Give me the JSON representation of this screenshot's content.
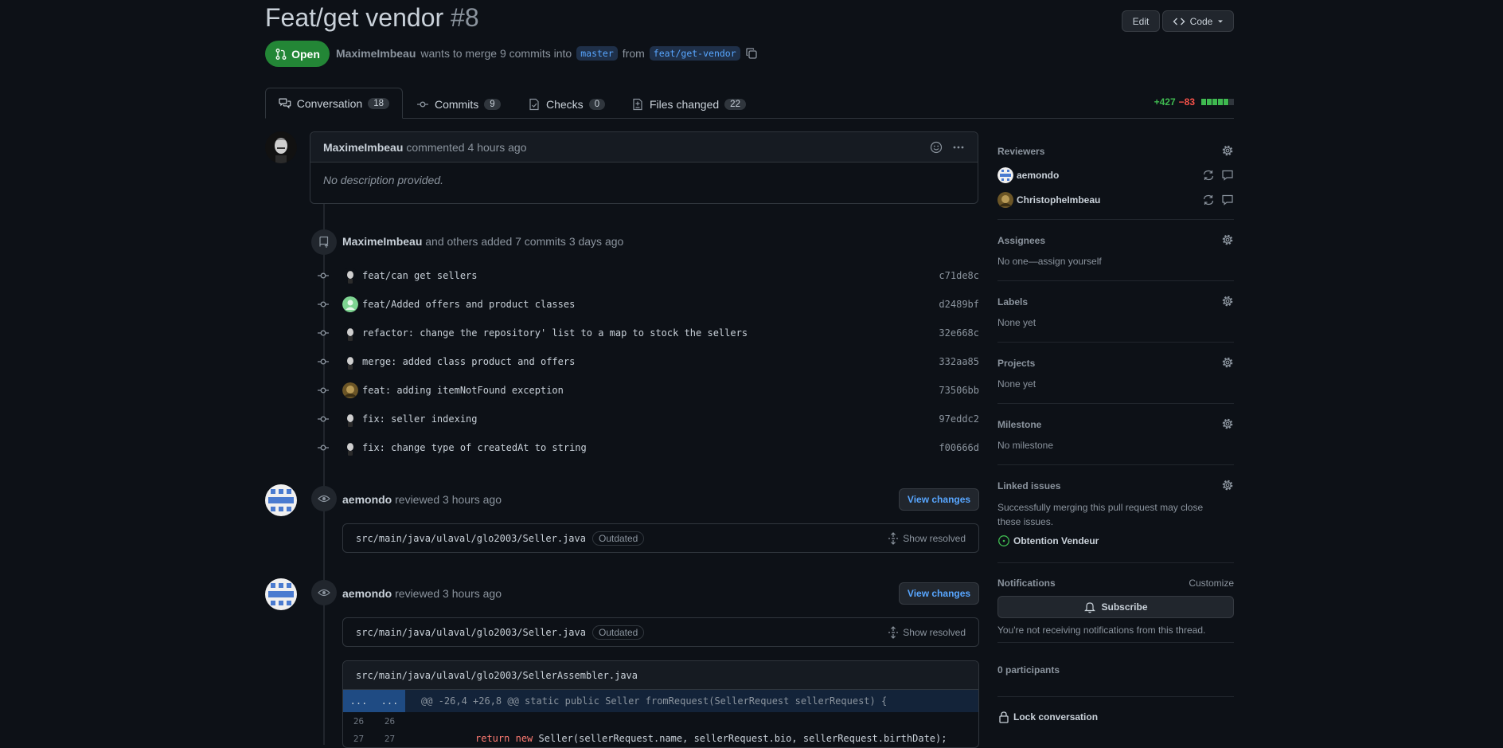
{
  "header": {
    "title": "Feat/get vendor",
    "number": "#8",
    "edit_label": "Edit",
    "code_label": "Code",
    "state": "Open",
    "author": "MaximeImbeau",
    "merge_text_pre": "wants to merge 9 commits into",
    "base_branch": "master",
    "from_text": "from",
    "head_branch": "feat/get-vendor"
  },
  "tabs": [
    {
      "label": "Conversation",
      "count": "18"
    },
    {
      "label": "Commits",
      "count": "9"
    },
    {
      "label": "Checks",
      "count": "0"
    },
    {
      "label": "Files changed",
      "count": "22"
    }
  ],
  "diffstat": {
    "additions": "+427",
    "deletions": "−83"
  },
  "comment": {
    "author": "MaximeImbeau",
    "action": "commented",
    "time": "4 hours ago",
    "body": "No description provided."
  },
  "commits_event": {
    "author": "MaximeImbeau",
    "text": "and others added 7 commits",
    "time": "3 days ago"
  },
  "commits": [
    {
      "message": "feat/can get sellers",
      "sha": "c71de8c",
      "avatar": "maxime"
    },
    {
      "message": "feat/Added offers and product classes",
      "sha": "d2489bf",
      "avatar": "green"
    },
    {
      "message": "refactor: change the repository' list to a map to stock the sellers",
      "sha": "32e668c",
      "avatar": "maxime"
    },
    {
      "message": "merge: added class product and offers",
      "sha": "332aa85",
      "avatar": "maxime"
    },
    {
      "message": "feat: adding itemNotFound exception",
      "sha": "73506bb",
      "avatar": "christophe"
    },
    {
      "message": "fix: seller indexing",
      "sha": "97eddc2",
      "avatar": "maxime"
    },
    {
      "message": "fix: change type of createdAt to string",
      "sha": "f00666d",
      "avatar": "maxime"
    }
  ],
  "reviews": [
    {
      "author": "aemondo",
      "action": "reviewed",
      "time": "3 hours ago",
      "button": "View changes",
      "file": "src/main/java/ulaval/glo2003/Seller.java",
      "badge": "Outdated",
      "show_resolved": "Show resolved"
    },
    {
      "author": "aemondo",
      "action": "reviewed",
      "time": "3 hours ago",
      "button": "View changes",
      "file": "src/main/java/ulaval/glo2003/Seller.java",
      "badge": "Outdated",
      "show_resolved": "Show resolved"
    }
  ],
  "code_file": {
    "path": "src/main/java/ulaval/glo2003/SellerAssembler.java",
    "hunk_left": "...",
    "hunk_right": "...",
    "hunk": "@@ -26,4 +26,8 @@ static public Seller fromRequest(SellerRequest sellerRequest) {",
    "lines": [
      {
        "old": "26",
        "new": "26",
        "kw1": "",
        "kw2": "",
        "code": ""
      },
      {
        "old": "27",
        "new": "27",
        "kw1": "return",
        "kw2": "new",
        "code": "Seller(sellerRequest.name, sellerRequest.bio, sellerRequest.birthDate);"
      }
    ]
  },
  "sidebar": {
    "reviewers_label": "Reviewers",
    "reviewers": [
      {
        "name": "aemondo"
      },
      {
        "name": "ChristopheImbeau"
      }
    ],
    "assignees_label": "Assignees",
    "assignees_value": "No one—assign yourself",
    "labels_label": "Labels",
    "labels_value": "None yet",
    "projects_label": "Projects",
    "projects_value": "None yet",
    "milestone_label": "Milestone",
    "milestone_value": "No milestone",
    "linked_label": "Linked issues",
    "linked_desc": "Successfully merging this pull request may close these issues.",
    "linked_issue": "Obtention Vendeur",
    "notifications_label": "Notifications",
    "customize_label": "Customize",
    "subscribe_label": "Subscribe",
    "notifications_desc": "You're not receiving notifications from this thread.",
    "participants": "0 participants",
    "lock_label": "Lock conversation"
  },
  "colors": {
    "bg": "#0d1117",
    "accent_blue": "#58a6ff",
    "open_green": "#238636",
    "add_green": "#3fb950",
    "del_red": "#f85149"
  }
}
